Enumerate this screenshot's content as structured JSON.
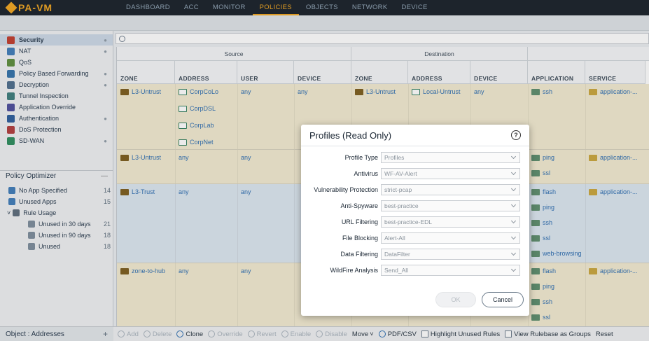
{
  "app": {
    "logo": "PA-VM"
  },
  "nav": [
    "DASHBOARD",
    "ACC",
    "MONITOR",
    "POLICIES",
    "OBJECTS",
    "NETWORK",
    "DEVICE"
  ],
  "sidebar": {
    "items": [
      {
        "label": "Security",
        "color": "#c0392b"
      },
      {
        "label": "NAT",
        "color": "#3d7ab8"
      },
      {
        "label": "QoS",
        "color": "#5a8b3a"
      },
      {
        "label": "Policy Based Forwarding",
        "color": "#2f6fa8"
      },
      {
        "label": "Decryption",
        "color": "#4a6a8a"
      },
      {
        "label": "Tunnel Inspection",
        "color": "#3a7a7a"
      },
      {
        "label": "Application Override",
        "color": "#4a4a9a"
      },
      {
        "label": "Authentication",
        "color": "#2a5a9a"
      },
      {
        "label": "DoS Protection",
        "color": "#b03a3a"
      },
      {
        "label": "SD-WAN",
        "color": "#2a8a5a"
      }
    ],
    "optimizer_title": "Policy Optimizer",
    "optimizer": [
      {
        "label": "No App Specified",
        "count": "14"
      },
      {
        "label": "Unused Apps",
        "count": "15"
      },
      {
        "label": "Rule Usage",
        "count": ""
      },
      {
        "label": "Unused in 30 days",
        "count": "21"
      },
      {
        "label": "Unused in 90 days",
        "count": "18"
      },
      {
        "label": "Unused",
        "count": "18"
      }
    ],
    "objects_label": "Object : Addresses"
  },
  "grid": {
    "group_source": "Source",
    "group_destination": "Destination",
    "columns": [
      "ZONE",
      "ADDRESS",
      "USER",
      "DEVICE",
      "ZONE",
      "ADDRESS",
      "DEVICE",
      "APPLICATION",
      "SERVICE"
    ],
    "rows": [
      {
        "src_zone": "L3-Untrust",
        "src_addr": [
          "CorpCoLo",
          "CorpDSL",
          "CorpLab",
          "CorpNet"
        ],
        "user": "any",
        "device": "any",
        "dst_zone": "L3-Untrust",
        "dst_addr": "Local-Untrust",
        "dst_device": "any",
        "apps": [
          "ssh"
        ],
        "service": "application-..."
      },
      {
        "src_zone": "L3-Untrust",
        "src_addr": [
          "any"
        ],
        "user": "any",
        "device": "",
        "dst_zone": "",
        "dst_addr": "",
        "dst_device": "",
        "apps": [
          "ping",
          "ssl"
        ],
        "service": "application-..."
      },
      {
        "src_zone": "L3-Trust",
        "src_addr": [
          "any"
        ],
        "user": "any",
        "device": "",
        "dst_zone": "",
        "dst_addr": "",
        "dst_device": "",
        "apps": [
          "flash",
          "ping",
          "ssh",
          "ssl",
          "web-browsing"
        ],
        "service": "application-..."
      },
      {
        "src_zone": "zone-to-hub",
        "src_addr": [
          "any"
        ],
        "user": "any",
        "device": "",
        "dst_zone": "",
        "dst_addr": "",
        "dst_device": "",
        "apps": [
          "flash",
          "ping",
          "ssh",
          "ssl"
        ],
        "service": "application-..."
      }
    ]
  },
  "bottom": {
    "add": "Add",
    "delete": "Delete",
    "clone": "Clone",
    "override": "Override",
    "revert": "Revert",
    "enable": "Enable",
    "disable": "Disable",
    "move": "Move",
    "pdf": "PDF/CSV",
    "highlight": "Highlight Unused Rules",
    "view_groups": "View Rulebase as Groups",
    "reset": "Reset"
  },
  "modal": {
    "title": "Profiles (Read Only)",
    "help": "?",
    "fields": [
      {
        "label": "Profile Type",
        "value": "Profiles"
      },
      {
        "label": "Antivirus",
        "value": "WF-AV-Alert"
      },
      {
        "label": "Vulnerability Protection",
        "value": "strict-pcap"
      },
      {
        "label": "Anti-Spyware",
        "value": "best-practice"
      },
      {
        "label": "URL Filtering",
        "value": "best-practice-EDL"
      },
      {
        "label": "File Blocking",
        "value": "Alert-All"
      },
      {
        "label": "Data Filtering",
        "value": "DataFilter"
      },
      {
        "label": "WildFire Analysis",
        "value": "Send_All"
      }
    ],
    "ok": "OK",
    "cancel": "Cancel"
  },
  "colors": {
    "row_tan": "#f2ead0",
    "row_blue": "#dbe6f0",
    "accent": "#f0a31c"
  }
}
